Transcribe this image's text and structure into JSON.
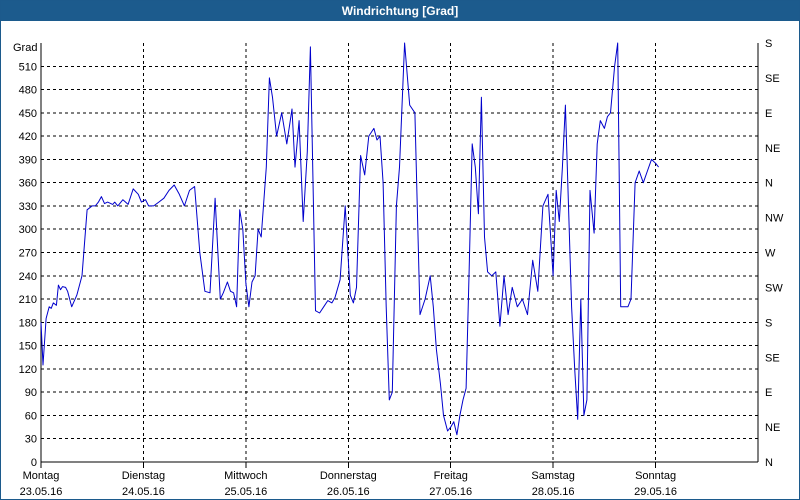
{
  "chart_data": {
    "type": "line",
    "title": "Windrichtung [Grad]",
    "ylabel": "Grad",
    "ylim": [
      0,
      540
    ],
    "y_ticks": [
      0,
      30,
      60,
      90,
      120,
      150,
      180,
      210,
      240,
      270,
      300,
      330,
      360,
      390,
      420,
      450,
      480,
      510
    ],
    "right_ticks": [
      {
        "value": 0,
        "label": "N"
      },
      {
        "value": 45,
        "label": "NE"
      },
      {
        "value": 90,
        "label": "E"
      },
      {
        "value": 135,
        "label": "SE"
      },
      {
        "value": 180,
        "label": "S"
      },
      {
        "value": 225,
        "label": "SW"
      },
      {
        "value": 270,
        "label": "W"
      },
      {
        "value": 315,
        "label": "NW"
      },
      {
        "value": 360,
        "label": "N"
      },
      {
        "value": 405,
        "label": "NE"
      },
      {
        "value": 450,
        "label": "E"
      },
      {
        "value": 495,
        "label": "SE"
      },
      {
        "value": 540,
        "label": "S"
      }
    ],
    "xlim": [
      0,
      7
    ],
    "x_ticks": [
      {
        "day": 0,
        "weekday": "Montag",
        "date": "23.05.16"
      },
      {
        "day": 1,
        "weekday": "Dienstag",
        "date": "24.05.16"
      },
      {
        "day": 2,
        "weekday": "Mittwoch",
        "date": "25.05.16"
      },
      {
        "day": 3,
        "weekday": "Donnerstag",
        "date": "26.05.16"
      },
      {
        "day": 4,
        "weekday": "Freitag",
        "date": "27.05.16"
      },
      {
        "day": 5,
        "weekday": "Samstag",
        "date": "28.05.16"
      },
      {
        "day": 6,
        "weekday": "Sonntag",
        "date": "29.05.16"
      }
    ],
    "grid": true,
    "series_color": "#0000cc",
    "x": [
      0.0,
      0.02,
      0.05,
      0.08,
      0.1,
      0.12,
      0.15,
      0.17,
      0.19,
      0.21,
      0.24,
      0.26,
      0.3,
      0.35,
      0.4,
      0.45,
      0.5,
      0.53,
      0.56,
      0.59,
      0.62,
      0.65,
      0.7,
      0.72,
      0.75,
      0.8,
      0.85,
      0.9,
      0.95,
      0.98,
      1.02,
      1.05,
      1.1,
      1.15,
      1.2,
      1.25,
      1.3,
      1.35,
      1.4,
      1.45,
      1.5,
      1.55,
      1.6,
      1.65,
      1.7,
      1.75,
      1.78,
      1.82,
      1.85,
      1.88,
      1.91,
      1.94,
      1.97,
      2.0,
      2.03,
      2.06,
      2.09,
      2.12,
      2.15,
      2.2,
      2.23,
      2.26,
      2.3,
      2.35,
      2.4,
      2.45,
      2.48,
      2.52,
      2.56,
      2.6,
      2.63,
      2.68,
      2.72,
      2.76,
      2.8,
      2.84,
      2.87,
      2.92,
      2.97,
      3.02,
      3.05,
      3.08,
      3.12,
      3.16,
      3.2,
      3.25,
      3.28,
      3.31,
      3.34,
      3.37,
      3.4,
      3.43,
      3.47,
      3.5,
      3.55,
      3.6,
      3.65,
      3.7,
      3.75,
      3.8,
      3.83,
      3.86,
      3.9,
      3.93,
      3.97,
      4.0,
      4.03,
      4.06,
      4.09,
      4.12,
      4.15,
      4.18,
      4.21,
      4.24,
      4.27,
      4.3,
      4.33,
      4.36,
      4.4,
      4.44,
      4.48,
      4.52,
      4.56,
      4.6,
      4.65,
      4.7,
      4.75,
      4.8,
      4.85,
      4.9,
      4.95,
      5.0,
      5.03,
      5.06,
      5.09,
      5.12,
      5.15,
      5.18,
      5.21,
      5.24,
      5.27,
      5.3,
      5.33,
      5.36,
      5.4,
      5.43,
      5.46,
      5.5,
      5.53,
      5.56,
      5.6,
      5.63,
      5.66,
      5.7,
      5.73,
      5.76,
      5.8,
      5.84,
      5.88,
      5.92,
      5.96,
      6.0,
      6.03,
      6.05,
      6.08,
      6.11,
      6.14,
      6.17,
      6.2,
      6.24,
      6.28,
      6.32,
      6.36,
      6.4,
      6.44,
      6.48,
      6.52,
      6.55,
      6.58,
      6.62,
      6.66,
      6.7,
      6.74,
      6.78,
      6.82,
      6.86,
      6.9,
      6.95,
      7.0
    ],
    "values": [
      180,
      125,
      185,
      200,
      198,
      205,
      202,
      228,
      222,
      226,
      225,
      220,
      200,
      215,
      240,
      325,
      330,
      330,
      335,
      342,
      333,
      335,
      332,
      335,
      330,
      338,
      332,
      352,
      345,
      335,
      338,
      330,
      330,
      335,
      340,
      350,
      357,
      345,
      330,
      350,
      355,
      270,
      220,
      218,
      340,
      210,
      218,
      232,
      220,
      218,
      200,
      325,
      300,
      230,
      200,
      232,
      240,
      300,
      290,
      380,
      495,
      470,
      420,
      450,
      410,
      455,
      380,
      440,
      310,
      400,
      535,
      195,
      192,
      200,
      208,
      205,
      212,
      235,
      330,
      215,
      205,
      225,
      395,
      370,
      420,
      430,
      415,
      420,
      360,
      200,
      80,
      90,
      330,
      380,
      540,
      460,
      450,
      190,
      210,
      240,
      200,
      145,
      100,
      60,
      40,
      45,
      52,
      35,
      60,
      80,
      95,
      250,
      410,
      380,
      320,
      470,
      290,
      245,
      240,
      245,
      175,
      240,
      190,
      225,
      200,
      210,
      190,
      260,
      220,
      330,
      345,
      240,
      350,
      310,
      380,
      460,
      330,
      200,
      120,
      55,
      210,
      60,
      80,
      350,
      295,
      410,
      440,
      430,
      445,
      450,
      510,
      540,
      200,
      200,
      200,
      210,
      360,
      375,
      360,
      375,
      390,
      385,
      380
    ]
  }
}
